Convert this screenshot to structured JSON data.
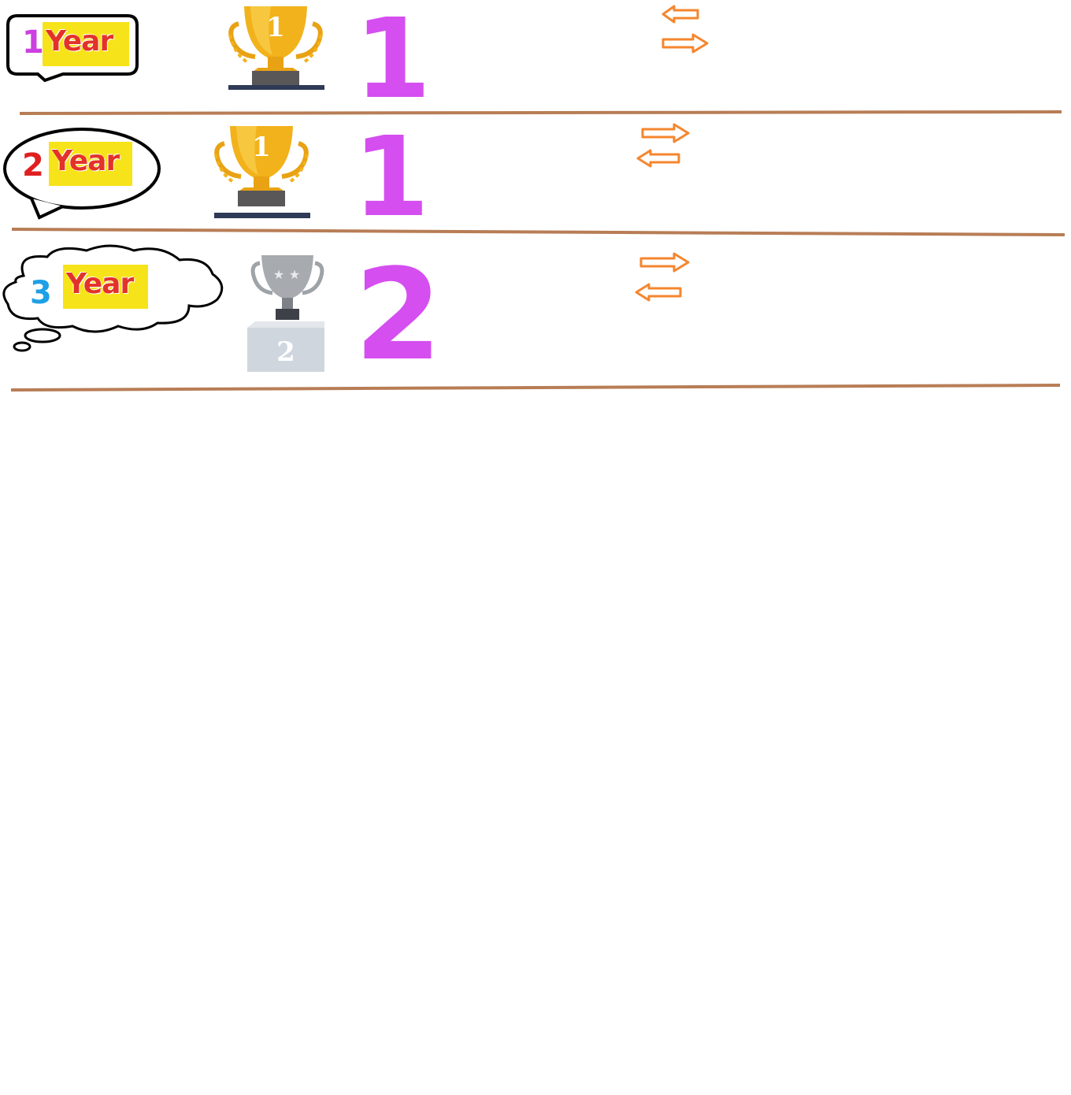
{
  "rows": [
    {
      "year_number": "1",
      "year_label": "Year",
      "trophy_number": "1",
      "rank": "1"
    },
    {
      "year_number": "2",
      "year_label": "Year",
      "trophy_number": "1",
      "rank": "1"
    },
    {
      "year_number": "3",
      "year_label": "Year",
      "trophy_number": "2",
      "rank": "2"
    }
  ],
  "colors": {
    "divider": "#b87d56",
    "rank": "#d54ef0",
    "arrow": "#f5862e",
    "badge_bg": "#f7e31a",
    "badge_text": "#e2322a",
    "year1_num": "#cc3fe0",
    "year2_num": "#e02020",
    "year3_num": "#1ea0e6",
    "gold": "#f2b21b",
    "silver": "#9ea3a8"
  },
  "icons": [
    "speech-bubble-icon",
    "oval-bubble-icon",
    "thought-cloud-icon",
    "gold-trophy-icon",
    "silver-trophy-icon",
    "arrow-left-icon",
    "arrow-right-icon"
  ]
}
